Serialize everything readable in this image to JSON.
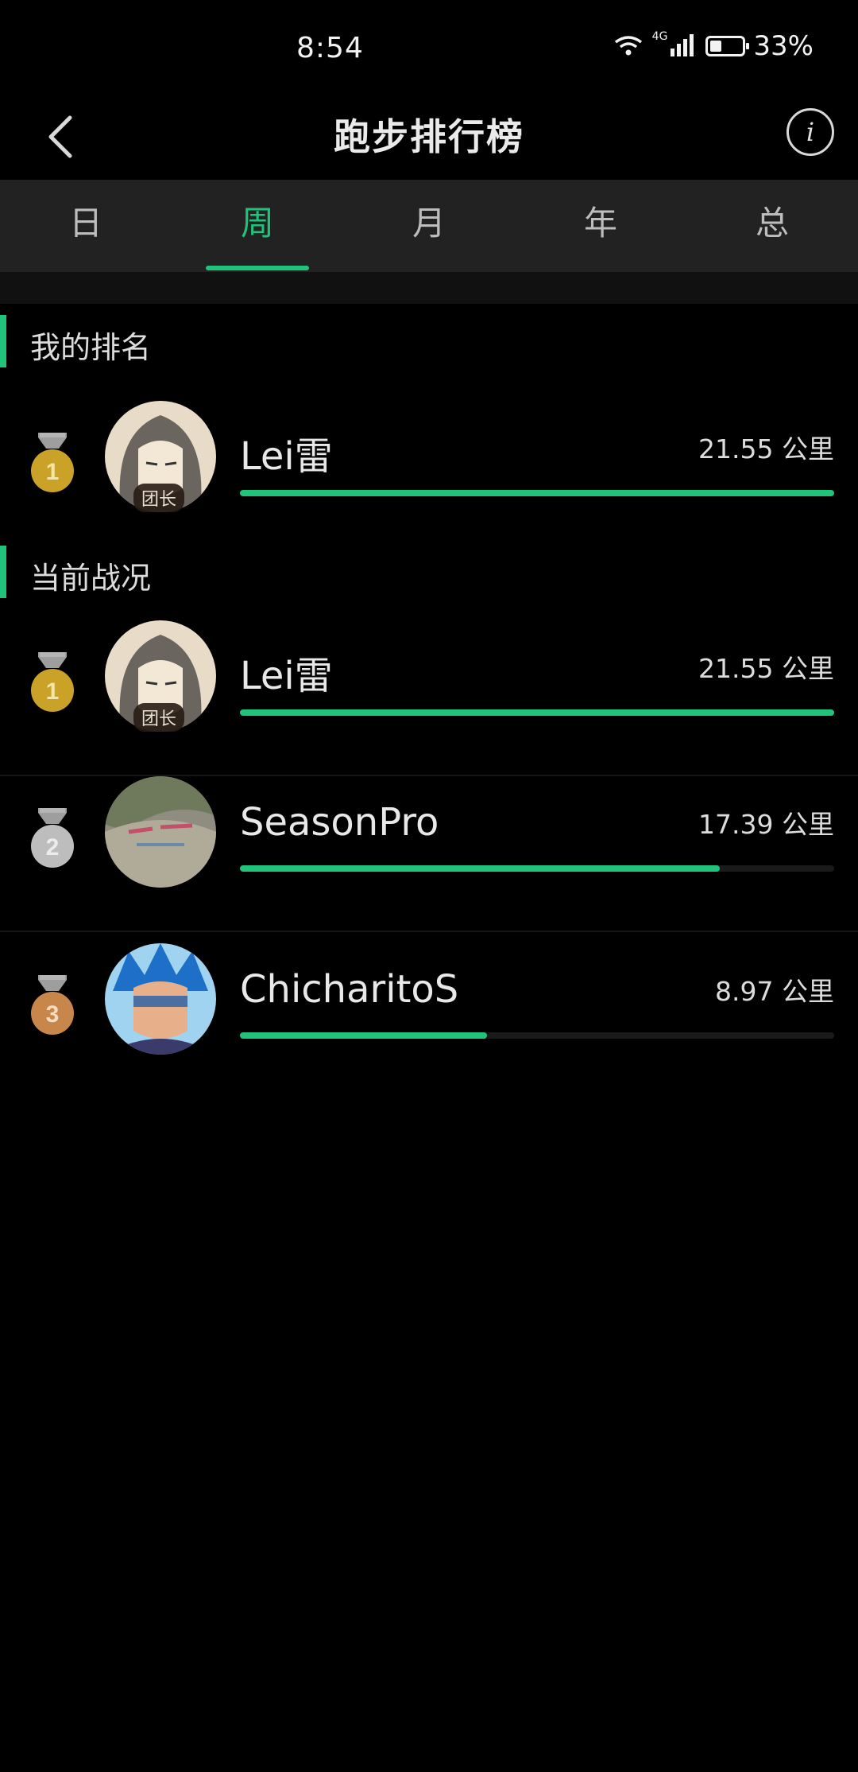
{
  "status_bar": {
    "time": "8:54",
    "battery_percent": "33%",
    "network": "4G",
    "icons": [
      "wifi-icon",
      "signal-icon",
      "battery-icon"
    ]
  },
  "header": {
    "title": "跑步排行榜",
    "info_label": "i"
  },
  "tabs": [
    {
      "label": "日",
      "active": false
    },
    {
      "label": "周",
      "active": true
    },
    {
      "label": "月",
      "active": false
    },
    {
      "label": "年",
      "active": false
    },
    {
      "label": "总",
      "active": false
    }
  ],
  "sections": {
    "my_rank": {
      "title": "我的排名",
      "entry": {
        "rank": 1,
        "name": "Lei雷",
        "distance": "21.55 公里",
        "progress": 1.0,
        "badge": "团长"
      }
    },
    "current": {
      "title": "当前战况",
      "entries": [
        {
          "rank": 1,
          "name": "Lei雷",
          "distance": "21.55 公里",
          "progress": 1.0,
          "badge": "团长"
        },
        {
          "rank": 2,
          "name": "SeasonPro",
          "distance": "17.39 公里",
          "progress": 0.807
        },
        {
          "rank": 3,
          "name": "ChicharitoS",
          "distance": "8.97 公里",
          "progress": 0.416
        }
      ]
    }
  },
  "colors": {
    "accent": "#1fc37a",
    "gold": "#c9a227",
    "silver": "#bdbdbd",
    "bronze": "#c8874a"
  }
}
